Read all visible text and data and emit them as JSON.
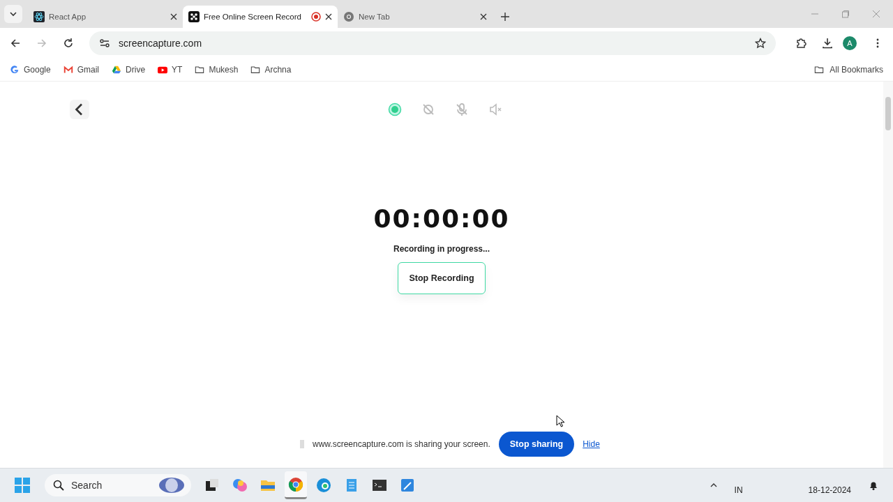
{
  "tabs": [
    {
      "title": "React App",
      "kind": "react",
      "selected": false,
      "recording": false
    },
    {
      "title": "Free Online Screen Record",
      "kind": "dice",
      "selected": true,
      "recording": true
    },
    {
      "title": "New Tab",
      "kind": "chrome",
      "selected": false,
      "recording": false
    }
  ],
  "address": {
    "value": "screencapture.com"
  },
  "profile": {
    "initial": "A"
  },
  "bookmarks": [
    {
      "label": "Google",
      "kind": "google"
    },
    {
      "label": "Gmail",
      "kind": "gmail"
    },
    {
      "label": "Drive",
      "kind": "drive"
    },
    {
      "label": "YT",
      "kind": "youtube"
    },
    {
      "label": "Mukesh",
      "kind": "folder"
    },
    {
      "label": "Archna",
      "kind": "folder"
    }
  ],
  "all_bookmarks": "All Bookmarks",
  "recorder": {
    "controls": [
      {
        "kind": "record",
        "on": true
      },
      {
        "kind": "camera",
        "on": false
      },
      {
        "kind": "mic",
        "on": false
      },
      {
        "kind": "sound",
        "on": false
      }
    ],
    "timer": "00:00:00",
    "status": "Recording in progress...",
    "stop_button": "Stop Recording"
  },
  "sharing_bar": {
    "message": "www.screencapture.com is sharing your screen.",
    "stop_button": "Stop sharing",
    "hide_link": "Hide"
  },
  "taskbar": {
    "search": {
      "placeholder": "Search"
    },
    "apps": [
      {
        "kind": "taskview",
        "selected": false
      },
      {
        "kind": "copilot",
        "selected": false
      },
      {
        "kind": "files",
        "selected": false
      },
      {
        "kind": "chrome",
        "selected": true
      },
      {
        "kind": "edge",
        "selected": false
      },
      {
        "kind": "notepad",
        "selected": false
      },
      {
        "kind": "terminal",
        "selected": false
      },
      {
        "kind": "paint",
        "selected": false
      }
    ],
    "language": "IN",
    "date": "18-12-2024"
  }
}
